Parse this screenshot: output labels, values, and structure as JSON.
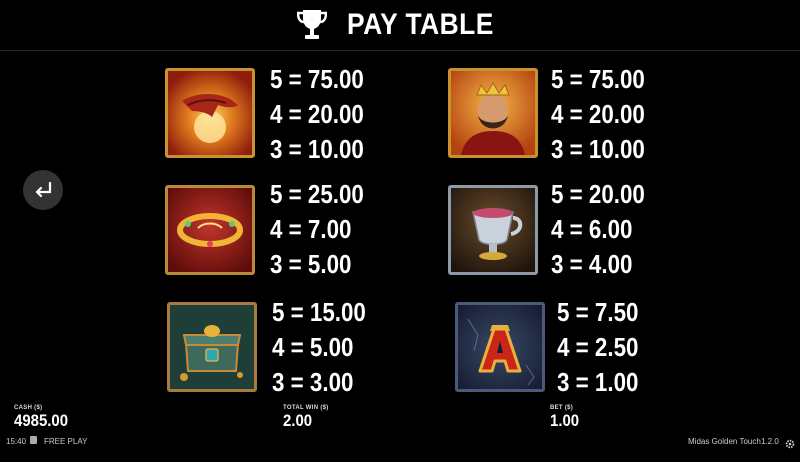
{
  "header": {
    "title": "PAY TABLE",
    "icon": "trophy-icon"
  },
  "back_button": {
    "icon": "return-arrow-icon"
  },
  "symbols": [
    {
      "name": "golden-hand",
      "pays": [
        "5 = 75.00",
        "4 = 20.00",
        "3 = 10.00"
      ]
    },
    {
      "name": "king-midas",
      "pays": [
        "5 = 75.00",
        "4 = 20.00",
        "3 = 10.00"
      ]
    },
    {
      "name": "golden-crown",
      "pays": [
        "5 = 25.00",
        "4 = 7.00",
        "3 = 5.00"
      ]
    },
    {
      "name": "silver-goblet",
      "pays": [
        "5 = 20.00",
        "4 = 6.00",
        "3 = 4.00"
      ]
    },
    {
      "name": "treasure-chest",
      "pays": [
        "5 = 15.00",
        "4 = 5.00",
        "3 = 3.00"
      ]
    },
    {
      "name": "letter-a",
      "pays": [
        "5 = 7.50",
        "4 = 2.50",
        "3 = 1.00"
      ]
    }
  ],
  "footer": {
    "cash_label": "CASH ($)",
    "cash_value": "4985.00",
    "total_win_label": "TOTAL WIN ($)",
    "total_win_value": "2.00",
    "bet_label": "BET ($)",
    "bet_value": "1.00"
  },
  "status_bar": {
    "time": "15:40",
    "mode": "FREE PLAY",
    "game_name": "Midas Golden Touch",
    "version": "1.2.0"
  },
  "colors": {
    "gold": "#e8b13a",
    "dark_red": "#8e1d0e",
    "background": "#000000"
  }
}
